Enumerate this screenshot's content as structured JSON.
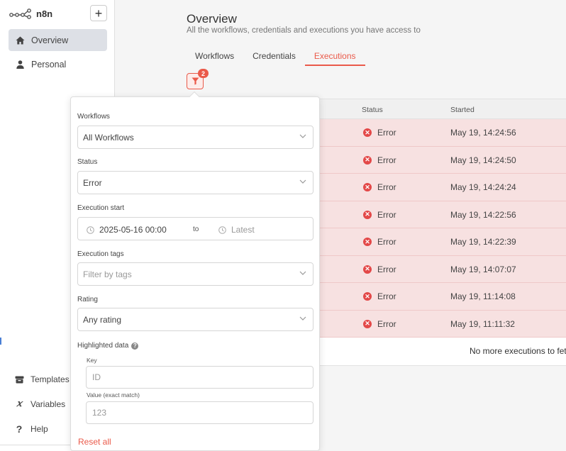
{
  "app": {
    "logo_text": "n8n",
    "accent": "#ea5a4a"
  },
  "sidebar": {
    "add_label": "+",
    "items": [
      {
        "label": "Overview",
        "icon": "home-icon"
      },
      {
        "label": "Personal",
        "icon": "user-icon"
      }
    ],
    "bottom": [
      {
        "label": "Templates",
        "icon": "box-icon"
      },
      {
        "label": "Variables",
        "icon": "variable-icon"
      },
      {
        "label": "Help",
        "icon": "question-icon"
      }
    ]
  },
  "header": {
    "title": "Overview",
    "subtitle": "All the workflows, credentials and executions you have access to",
    "tabs": [
      {
        "label": "Workflows"
      },
      {
        "label": "Credentials"
      },
      {
        "label": "Executions",
        "active": true
      }
    ],
    "filter_badge": "2"
  },
  "table": {
    "columns": {
      "status": "Status",
      "started": "Started"
    },
    "rows": [
      {
        "status": "Error",
        "started": "May 19, 14:24:56"
      },
      {
        "status": "Error",
        "started": "May 19, 14:24:50"
      },
      {
        "status": "Error",
        "started": "May 19, 14:24:24"
      },
      {
        "status": "Error",
        "started": "May 19, 14:22:56"
      },
      {
        "status": "Error",
        "started": "May 19, 14:22:39"
      },
      {
        "status": "Error",
        "started": "May 19, 14:07:07"
      },
      {
        "status": "Error",
        "started": "May 19, 11:14:08"
      },
      {
        "status": "Error",
        "started": "May 19, 11:11:32"
      }
    ],
    "footer": "No more executions to fetch"
  },
  "filter": {
    "workflows_label": "Workflows",
    "workflows_value": "All Workflows",
    "status_label": "Status",
    "status_value": "Error",
    "exec_start_label": "Execution start",
    "start_value": "2025-05-16 00:00",
    "to_label": "to",
    "end_placeholder": "Latest",
    "tags_label": "Execution tags",
    "tags_placeholder": "Filter by tags",
    "rating_label": "Rating",
    "rating_value": "Any rating",
    "highlighted_label": "Highlighted data",
    "key_label": "Key",
    "key_placeholder": "ID",
    "value_label": "Value (exact match)",
    "value_placeholder": "123",
    "reset_label": "Reset all"
  }
}
